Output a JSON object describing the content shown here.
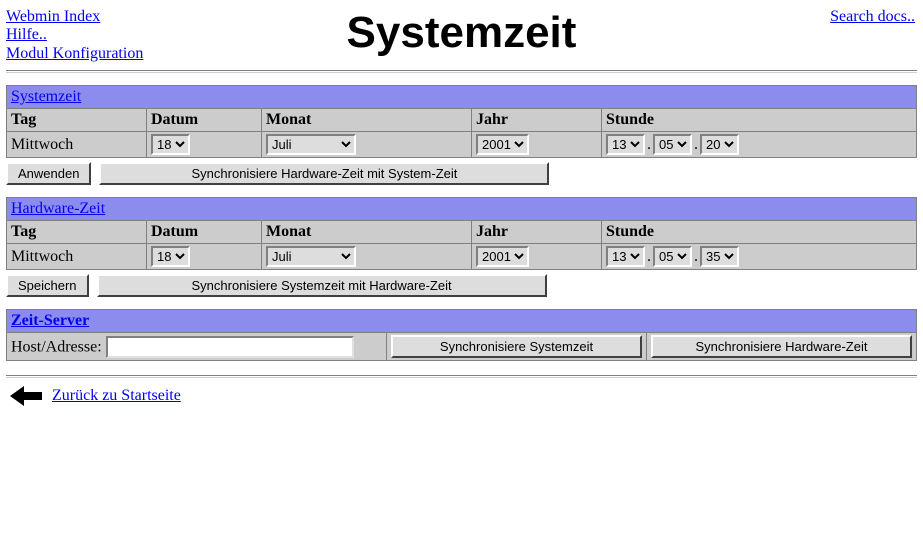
{
  "header": {
    "links": {
      "webmin_index": "Webmin Index",
      "hilfe": "Hilfe..",
      "modul_konfig": "Modul Konfiguration"
    },
    "search": "Search docs..",
    "title": "Systemzeit"
  },
  "systemzeit": {
    "title": "Systemzeit",
    "labels": {
      "tag": "Tag",
      "datum": "Datum",
      "monat": "Monat",
      "jahr": "Jahr",
      "stunde": "Stunde"
    },
    "values": {
      "tag": "Mittwoch",
      "datum": "18",
      "monat": "Juli",
      "jahr": "2001",
      "h": "13",
      "m": "05",
      "s": "20"
    },
    "buttons": {
      "apply": "Anwenden",
      "sync": "Synchronisiere Hardware-Zeit mit System-Zeit"
    }
  },
  "hardwarezeit": {
    "title": "Hardware-Zeit",
    "labels": {
      "tag": "Tag",
      "datum": "Datum",
      "monat": "Monat",
      "jahr": "Jahr",
      "stunde": "Stunde"
    },
    "values": {
      "tag": "Mittwoch",
      "datum": "18",
      "monat": "Juli",
      "jahr": "2001",
      "h": "13",
      "m": "05",
      "s": "35"
    },
    "buttons": {
      "save": "Speichern",
      "sync": "Synchronisiere Systemzeit mit Hardware-Zeit"
    }
  },
  "zeitserver": {
    "title": "Zeit-Server",
    "host_label": "Host/Adresse:",
    "host_value": "",
    "buttons": {
      "sync_sys": "Synchronisiere Systemzeit",
      "sync_hw": "Synchronisiere Hardware-Zeit"
    }
  },
  "footer": {
    "back": "Zurück zu Startseite"
  },
  "time_sep1": ".",
  "time_sep2": "."
}
